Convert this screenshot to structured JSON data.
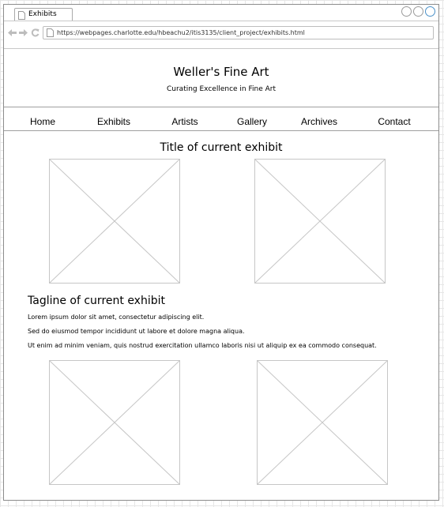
{
  "browser": {
    "tab_title": "Exhibits",
    "url": "https://webpages.charlotte.edu/hbeachu2/itis3135/client_project/exhibits.html",
    "nav_icons": [
      "back-arrow-icon",
      "forward-arrow-icon",
      "reload-icon"
    ]
  },
  "site": {
    "title": "Weller's Fine Art",
    "subtitle": "Curating Excellence in Fine Art"
  },
  "nav": {
    "items": [
      {
        "label": "Home"
      },
      {
        "label": "Exhibits"
      },
      {
        "label": "Artists"
      },
      {
        "label": "Gallery"
      },
      {
        "label": "Archives"
      },
      {
        "label": "Contact"
      }
    ]
  },
  "main": {
    "exhibit_title": "Title of current exhibit",
    "tagline": "Tagline of current exhibit",
    "paragraphs": [
      "Lorem ipsum dolor sit amet, consectetur adipiscing elit.",
      "Sed do eiusmod tempor incididunt ut labore et dolore magna aliqua.",
      "Ut enim ad minim veniam, quis nostrud exercitation ullamco laboris nisi ut aliquip ex ea commodo consequat."
    ]
  },
  "colors": {
    "window_border": "#8c8c8c",
    "placeholder_stroke": "#c6c6c6",
    "grid": "#e6e6e6",
    "active_control": "#4a90c8"
  }
}
